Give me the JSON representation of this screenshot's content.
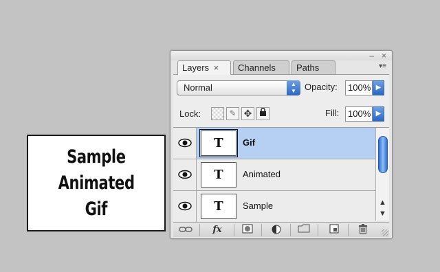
{
  "sample_card": {
    "lines": [
      "Sample",
      "Animated",
      "Gif"
    ]
  },
  "palette": {
    "window_controls": {
      "minimize": "–",
      "close": "×"
    },
    "tabs": [
      {
        "label": "Layers",
        "active": true,
        "close": "×"
      },
      {
        "label": "Channels",
        "active": false
      },
      {
        "label": "Paths",
        "active": false
      }
    ],
    "menu_icon": "▾≡",
    "blend_mode": "Normal",
    "opacity": {
      "label": "Opacity:",
      "value": "100%"
    },
    "lock": {
      "label": "Lock:"
    },
    "fill": {
      "label": "Fill:",
      "value": "100%"
    },
    "layers": [
      {
        "name": "Gif",
        "thumb": "T",
        "selected": true
      },
      {
        "name": "Animated",
        "thumb": "T",
        "selected": false
      },
      {
        "name": "Sample",
        "thumb": "T",
        "selected": false
      }
    ],
    "bottom_icons": [
      "link-icon",
      "fx-icon",
      "mask-icon",
      "adjustment-icon",
      "folder-icon",
      "new-layer-icon",
      "trash-icon"
    ],
    "fx_label": "fx",
    "colors": {
      "selected_row": "#b5d0f2",
      "accent": "#2b66c5"
    }
  }
}
